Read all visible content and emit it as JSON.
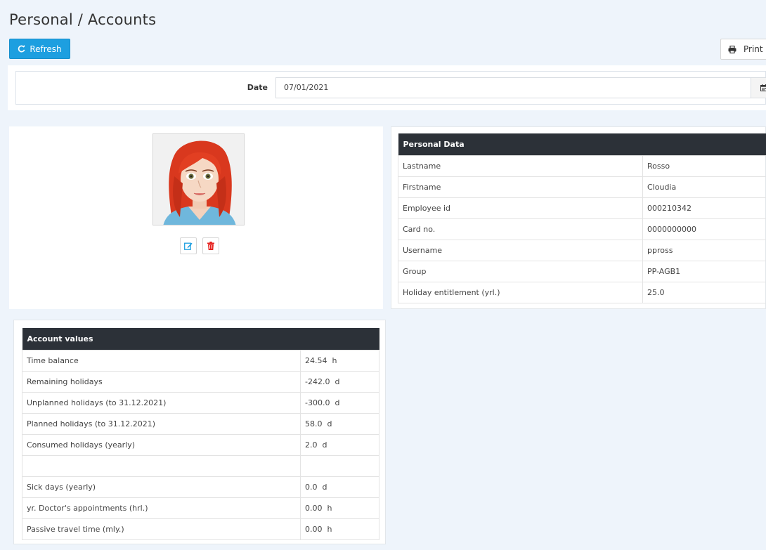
{
  "header": {
    "title": "Personal / Accounts",
    "refresh_label": "Refresh",
    "print_label": "Print"
  },
  "date_filter": {
    "label": "Date",
    "value": "07/01/2021"
  },
  "personal_data": {
    "heading": "Personal Data",
    "rows": [
      {
        "label": "Lastname",
        "value": "Rosso"
      },
      {
        "label": "Firstname",
        "value": "Cloudia"
      },
      {
        "label": "Employee id",
        "value": "000210342"
      },
      {
        "label": "Card no.",
        "value": "0000000000"
      },
      {
        "label": "Username",
        "value": "ppross"
      },
      {
        "label": "Group",
        "value": "PP-AGB1"
      },
      {
        "label": "Holiday entitlement (yrl.)",
        "value": "25.0"
      }
    ]
  },
  "account_values": {
    "heading": "Account values",
    "rows": [
      {
        "label": "Time balance",
        "value": "24.54  h"
      },
      {
        "label": "Remaining holidays",
        "value": "-242.0  d"
      },
      {
        "label": "Unplanned holidays (to 31.12.2021)",
        "value": "-300.0  d"
      },
      {
        "label": "Planned holidays (to 31.12.2021)",
        "value": "58.0  d"
      },
      {
        "label": "Consumed holidays (yearly)",
        "value": "2.0  d"
      },
      {
        "label": "",
        "value": ""
      },
      {
        "label": "Sick days (yearly)",
        "value": "0.0  d"
      },
      {
        "label": "yr. Doctor's appointments (hrl.)",
        "value": "0.00  h"
      },
      {
        "label": "Passive travel time (mly.)",
        "value": "0.00  h"
      }
    ]
  },
  "icons": {
    "refresh": "refresh-icon",
    "print": "printer-icon",
    "calendar": "calendar-icon",
    "edit": "edit-icon",
    "delete": "trash-icon",
    "avatar": "avatar-image"
  },
  "colors": {
    "primary": "#1d9fe0",
    "table_header": "#2c3138",
    "delete": "#e5211e",
    "background": "#eef4fb"
  }
}
